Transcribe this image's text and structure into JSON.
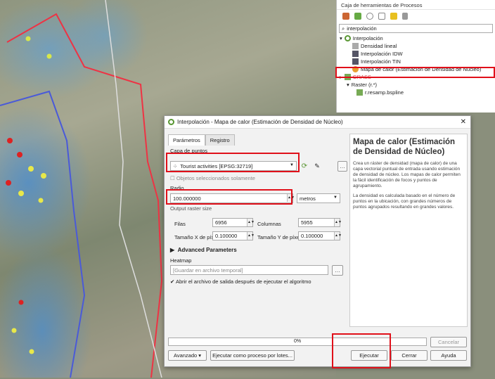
{
  "toolbox": {
    "title": "Caja de herramientas de Procesos",
    "search": "interpolación",
    "items": [
      {
        "label": "Interpolación",
        "indent": 0,
        "caret": "▾"
      },
      {
        "label": "Densidad lineal",
        "indent": 2
      },
      {
        "label": "Interpolación IDW",
        "indent": 2
      },
      {
        "label": "Interpolación TIN",
        "indent": 2
      },
      {
        "label": "Mapa de calor (Estimación de Densidad de Núcleo)",
        "indent": 2
      },
      {
        "label": "GRASS",
        "indent": 0,
        "caret": "▸"
      },
      {
        "label": "Raster (r.*)",
        "indent": 1,
        "caret": "▾"
      },
      {
        "label": "r.resamp.bspline",
        "indent": 2
      }
    ]
  },
  "dialog": {
    "title": "Interpolación - Mapa de calor (Estimación de Densidad de Núcleo)",
    "tab1": "Parámetros",
    "tab2": "Registro",
    "capa_label": "Capa de puntos",
    "capa_value": "Tourist activities [EPSG:32719]",
    "selected_only": "Objetos seleccionados solamente",
    "radio_label": "Radio",
    "radio_value": "100.000000",
    "units": "metros",
    "raster_label": "Output raster size",
    "filas_label": "Filas",
    "filas": "6956",
    "cols_label": "Columnas",
    "cols": "5955",
    "px_label": "Tamaño X de píxel",
    "px": "0.100000",
    "py_label": "Tamaño Y de píxel",
    "py": "0.100000",
    "adv": "Advanced Parameters",
    "heat_label": "Heatmap",
    "heat_placeholder": "[Guardar en archivo temporal]",
    "open_after": "Abrir el archivo de salida después de ejecutar el algoritmo",
    "progress": "0%",
    "cancel": "Cancelar",
    "avanzado": "Avanzado",
    "batch": "Ejecutar como proceso por lotes...",
    "run": "Ejecutar",
    "close": "Cerrar",
    "help": "Ayuda",
    "help_title": "Mapa de calor (Estimación de Densidad de Núcleo)",
    "help_p1": "Crea un ráster de densidad (mapa de calor) de una capa vectorial puntual de entrada usando estimación de densidad de núcleo. Los mapas de calor permiten la fácil identificación de focos y puntos de agrupamiento.",
    "help_p2": "La densidad es calculada basado en el número de puntos en la ubicación, con grandes números de puntos agrupados resultando en grandes valores."
  },
  "colors": {
    "accent": "#e0101a",
    "qgis_green": "#589632"
  }
}
